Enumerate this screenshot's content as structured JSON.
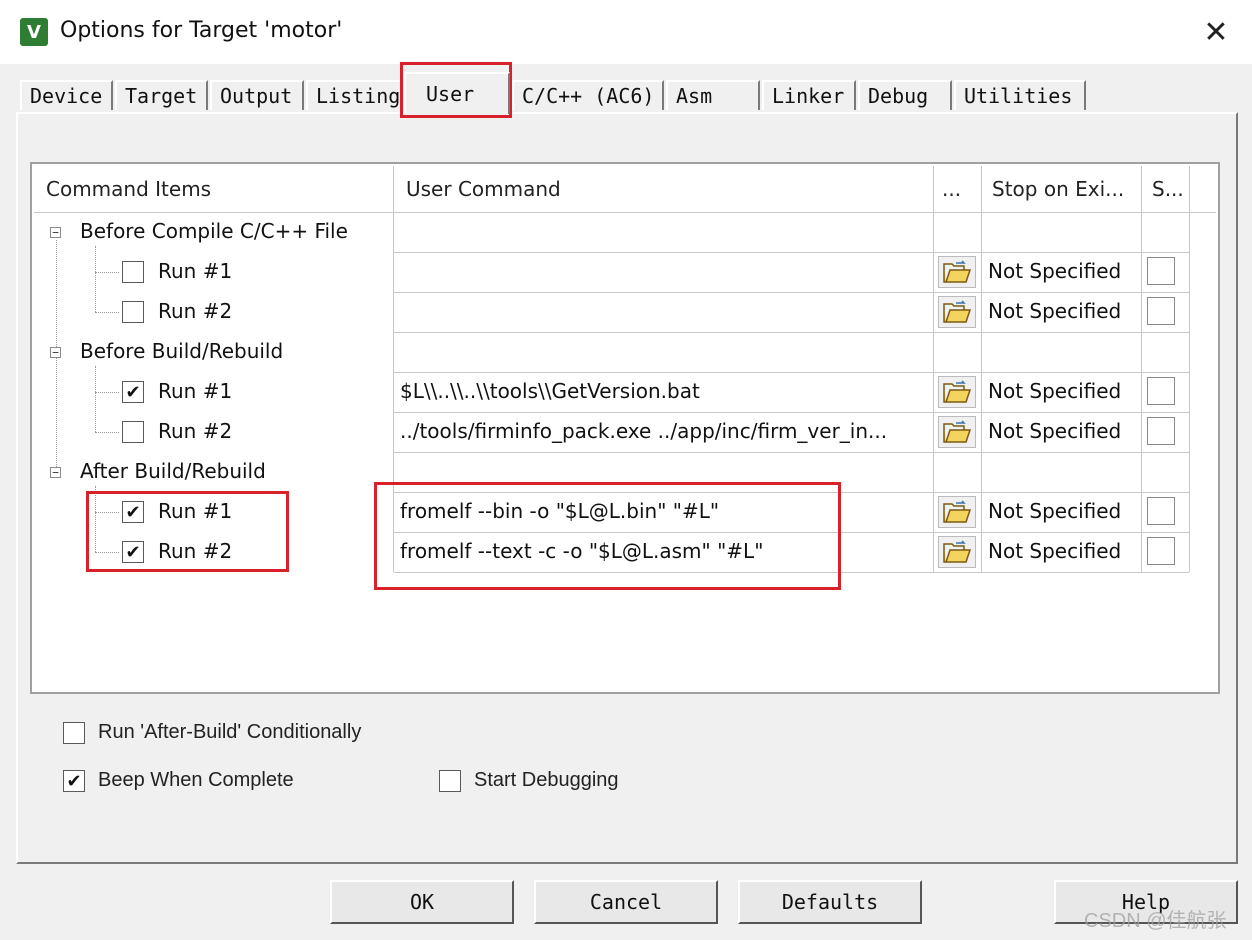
{
  "window": {
    "title": "Options for Target 'motor'",
    "icon_text": "V",
    "close_glyph": "✕"
  },
  "tabs": [
    {
      "label": "Device"
    },
    {
      "label": "Target"
    },
    {
      "label": "Output"
    },
    {
      "label": "Listing"
    },
    {
      "label": "User",
      "active": true
    },
    {
      "label": "C/C++ (AC6)"
    },
    {
      "label": "Asm"
    },
    {
      "label": "Linker"
    },
    {
      "label": "Debug"
    },
    {
      "label": "Utilities"
    }
  ],
  "grid": {
    "headers": {
      "command_items": "Command Items",
      "user_command": "User Command",
      "browse": "...",
      "stop_on_exit": "Stop on Exi...",
      "s": "S..."
    },
    "groups": [
      {
        "label": "Before Compile C/C++ File",
        "expander": "−",
        "runs": [
          {
            "label": "Run #1",
            "checked": false,
            "command": "",
            "stop": "Not Specified"
          },
          {
            "label": "Run #2",
            "checked": false,
            "command": "",
            "stop": "Not Specified"
          }
        ]
      },
      {
        "label": "Before Build/Rebuild",
        "expander": "−",
        "runs": [
          {
            "label": "Run #1",
            "checked": true,
            "command": "$L\\\\..\\\\..\\\\tools\\\\GetVersion.bat",
            "stop": "Not Specified"
          },
          {
            "label": "Run #2",
            "checked": false,
            "command": "../tools/firminfo_pack.exe ../app/inc/firm_ver_in...",
            "stop": "Not Specified"
          }
        ]
      },
      {
        "label": "After Build/Rebuild",
        "expander": "−",
        "runs": [
          {
            "label": "Run #1",
            "checked": true,
            "command": "fromelf --bin -o \"$L@L.bin\" \"#L\"",
            "stop": "Not Specified"
          },
          {
            "label": "Run #2",
            "checked": true,
            "command": "fromelf --text -c -o \"$L@L.asm\" \"#L\"",
            "stop": "Not Specified"
          }
        ]
      }
    ]
  },
  "options": {
    "run_after_build_conditionally": {
      "label": "Run 'After-Build' Conditionally",
      "checked": false
    },
    "beep_when_complete": {
      "label": "Beep When Complete",
      "checked": true
    },
    "start_debugging": {
      "label": "Start Debugging",
      "checked": false
    }
  },
  "buttons": {
    "ok": "OK",
    "cancel": "Cancel",
    "defaults": "Defaults",
    "help": "Help"
  },
  "check_glyph": "✔",
  "watermark": "CSDN @佳航张",
  "colors": {
    "highlight_red": "#d8212b",
    "dialog_bg": "#f0f0f0",
    "app_icon_green": "#2f7d32"
  }
}
